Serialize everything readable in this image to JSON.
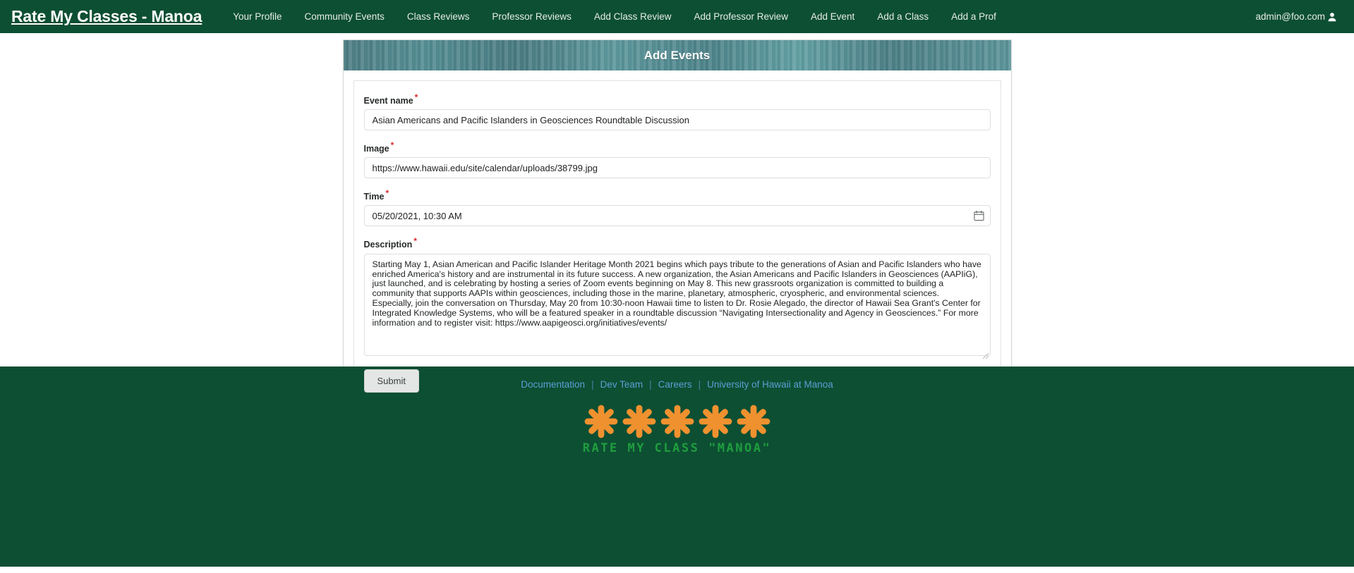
{
  "navbar": {
    "brand": "Rate My Classes - Manoa",
    "links": [
      {
        "label": "Your Profile"
      },
      {
        "label": "Community Events"
      },
      {
        "label": "Class Reviews"
      },
      {
        "label": "Professor Reviews"
      },
      {
        "label": "Add Class Review"
      },
      {
        "label": "Add Professor Review"
      },
      {
        "label": "Add Event"
      },
      {
        "label": "Add a Class"
      },
      {
        "label": "Add a Prof"
      }
    ],
    "user_email": "admin@foo.com",
    "user_icon": "user-account-icon"
  },
  "card": {
    "header_title": "Add Events",
    "required_marker": "*",
    "fields": {
      "event_name": {
        "label": "Event name",
        "value": "Asian Americans and Pacific Islanders in Geosciences Roundtable Discussion",
        "placeholder": "Event name",
        "required": true
      },
      "image": {
        "label": "Image",
        "value": "https://www.hawaii.edu/site/calendar/uploads/38799.jpg",
        "placeholder": "Image",
        "required": true
      },
      "time": {
        "label": "Time",
        "value": "05/20/2021, 10:30 AM",
        "placeholder": "mm/dd/yyyy, --:-- --",
        "required": true,
        "picker_icon": "calendar-icon"
      },
      "description": {
        "label": "Description",
        "value": "Starting May 1, Asian American and Pacific Islander Heritage Month 2021 begins which pays tribute to the generations of Asian and Pacific Islanders who have enriched America's history and are instrumental in its future success. A new organization, the Asian Americans and Pacific Islanders in Geosciences (AAPIiG), just launched, and is celebrating by hosting a series of Zoom events beginning on May 8. This new grassroots organization is committed to building a community that supports AAPIs within geosciences, including those in the marine, planetary, atmospheric, cryospheric, and environmental sciences. Especially, join the conversation on Thursday, May 20 from 10:30-noon Hawaii time to listen to Dr. Rosie Alegado, the director of Hawaii Sea Grant's Center for Integrated Knowledge Systems, who will be a featured speaker in a roundtable discussion “Navigating Intersectionality and Agency in Geosciences.” For more information and to register visit: https://www.aapigeosci.org/initiatives/events/",
        "placeholder": "Description",
        "required": true
      }
    },
    "submit_label": "Submit"
  },
  "footer": {
    "links": [
      {
        "label": "Documentation"
      },
      {
        "label": "Dev Team"
      },
      {
        "label": "Careers"
      },
      {
        "label": "University of Hawaii at Manoa"
      }
    ],
    "separator": "|",
    "logo_text": "RATE MY CLASS \"MANOA\"",
    "flower_count": 5
  },
  "colors": {
    "nav_green": "#0d4f33",
    "header_teal": "#4e7e84",
    "flower_orange": "#f0912f",
    "logo_green": "#1f9e3e",
    "footer_link_blue": "#5b9fd6",
    "required_red": "#db2828"
  }
}
